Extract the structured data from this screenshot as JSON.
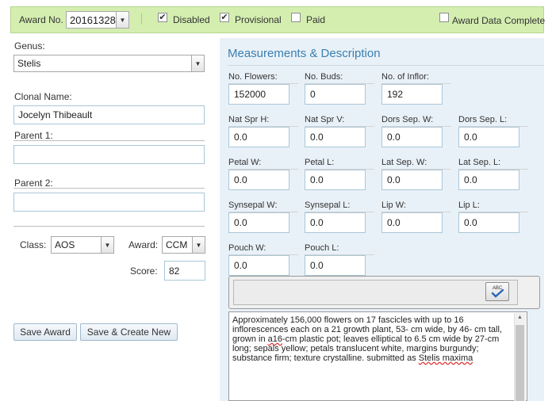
{
  "topbar": {
    "award_no_label": "Award No.",
    "award_no_value": "20161328",
    "disabled_label": "Disabled",
    "disabled_checked": true,
    "provisional_label": "Provisional",
    "provisional_checked": true,
    "paid_label": "Paid",
    "paid_checked": false,
    "award_data_complete_label": "Award Data Complete",
    "award_data_complete_checked": false
  },
  "left": {
    "genus_label": "Genus:",
    "genus_value": "Stelis",
    "clonal_name_label": "Clonal Name:",
    "clonal_name_value": "Jocelyn Thibeault",
    "parent1_label": "Parent 1:",
    "parent1_value": "",
    "parent2_label": "Parent 2:",
    "parent2_value": "",
    "class_label": "Class:",
    "class_value": "AOS",
    "award_label": "Award:",
    "award_value": "CCM",
    "score_label": "Score:",
    "score_value": "82",
    "save_award_label": "Save Award",
    "save_create_new_label": "Save & Create New"
  },
  "panel": {
    "title": "Measurements & Description",
    "fields": [
      {
        "label": "No. Flowers:",
        "value": "152000"
      },
      {
        "label": "No. Buds:",
        "value": "0"
      },
      {
        "label": "No. of Inflor:",
        "value": "192"
      },
      {
        "label": "Nat Spr H:",
        "value": "0.0"
      },
      {
        "label": "Nat Spr V:",
        "value": "0.0"
      },
      {
        "label": "Dors Sep. W:",
        "value": "0.0"
      },
      {
        "label": "Dors Sep. L:",
        "value": "0.0"
      },
      {
        "label": "Petal W:",
        "value": "0.0"
      },
      {
        "label": "Petal L:",
        "value": "0.0"
      },
      {
        "label": "Lat Sep. W:",
        "value": "0.0"
      },
      {
        "label": "Lat Sep. L:",
        "value": "0.0"
      },
      {
        "label": "Synsepal W:",
        "value": "0.0"
      },
      {
        "label": "Synsepal L:",
        "value": "0.0"
      },
      {
        "label": "Lip W:",
        "value": "0.0"
      },
      {
        "label": "Lip L:",
        "value": "0.0"
      },
      {
        "label": "Pouch W:",
        "value": "0.0"
      },
      {
        "label": "Pouch L:",
        "value": "0.0"
      }
    ],
    "description": {
      "part1": "Approximately 156,000 flowers on 17 fascicles with up to 16\ninflorescences each on a 21 growth plant, 53- cm wide, by 46- cm tall,\ngrown in ",
      "misspell1": "a16",
      "part2": "-cm plastic pot; leaves elliptical to 6.5 cm wide by 27-cm\nlong; sepals yellow; petals translucent white, margins burgundy;\nsubstance firm; texture crystalline. submitted as ",
      "misspell2": "Stelis maxima",
      "spellcheck_icon_text": "ABC"
    }
  }
}
